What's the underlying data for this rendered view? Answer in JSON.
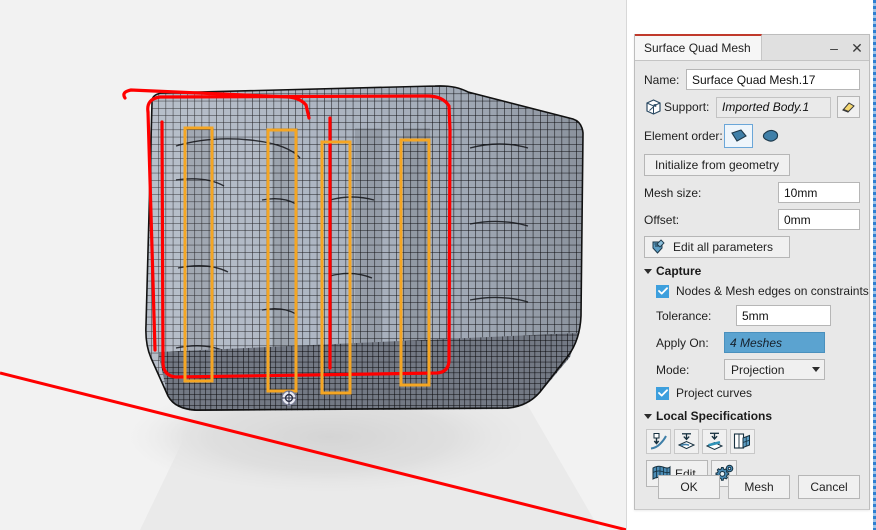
{
  "dialog": {
    "title": "Surface Quad Mesh",
    "window_controls": {
      "minimize": "–",
      "close": "✕"
    },
    "name_label": "Name:",
    "name_value": "Surface Quad Mesh.17",
    "support_label": "Support:",
    "support_value": "Imported Body.1",
    "support_icon": "box-wireframe-icon",
    "support_pick_icon": "eraser-icon",
    "element_order_label": "Element order:",
    "element_order_linear_icon": "linear-element-icon",
    "element_order_parabolic_icon": "parabolic-element-icon",
    "initialize_button": "Initialize from geometry",
    "mesh_size_label": "Mesh size:",
    "mesh_size_value": "10mm",
    "offset_label": "Offset:",
    "offset_value": "0mm",
    "edit_all_parameters_button": "Edit all parameters",
    "edit_all_parameters_icon": "parameters-icon",
    "capture": {
      "header": "Capture",
      "nodes_checkbox_label": "Nodes & Mesh edges on constraints",
      "nodes_checked": true,
      "tolerance_label": "Tolerance:",
      "tolerance_value": "5mm",
      "apply_on_label": "Apply On:",
      "apply_on_value": "4 Meshes",
      "mode_label": "Mode:",
      "mode_value": "Projection",
      "project_curves_label": "Project curves",
      "project_curves_checked": true
    },
    "local_specs": {
      "header": "Local Specifications",
      "tools": [
        "local-mesh-size-icon",
        "local-sag-icon",
        "imposed-edge-icon",
        "mesh-capture-icon"
      ],
      "edit_button": "Edit",
      "edit_icon": "mesh-edit-icon",
      "settings_icon": "gears-icon"
    },
    "footer": {
      "ok": "OK",
      "mesh": "Mesh",
      "cancel": "Cancel"
    }
  },
  "viewport": {
    "model_name": "quad-mesh-surface-model",
    "compass_icon": "origin-axis-icon",
    "colors": {
      "background": "#f2f2f2",
      "mesh_fill": "#aab0bd",
      "mesh_wire": "#111111",
      "highlight_red": "#ff0000",
      "highlight_orange": "#f5a623",
      "shadow": "#d9d9d9",
      "accent_blue": "#5ba3d0"
    }
  }
}
